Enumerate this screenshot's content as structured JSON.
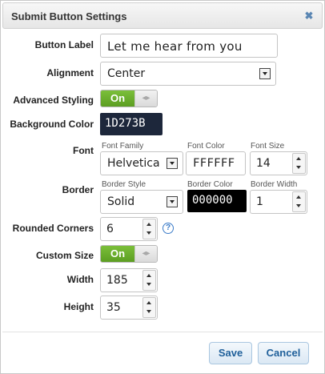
{
  "dialog": {
    "title": "Submit Button Settings",
    "close_glyph": "✖"
  },
  "fields": {
    "button_label": {
      "label": "Button Label",
      "value": "Let me hear from you"
    },
    "alignment": {
      "label": "Alignment",
      "value": "Center"
    },
    "advanced_styling": {
      "label": "Advanced Styling",
      "state": "On",
      "grip": "◂▸"
    },
    "background_color": {
      "label": "Background Color",
      "value": "1D273B",
      "color": "#1D273B"
    },
    "font": {
      "label": "Font",
      "family_label": "Font Family",
      "family_value": "Helvetica",
      "color_label": "Font Color",
      "color_value": "FFFFFF",
      "size_label": "Font Size",
      "size_value": "14"
    },
    "border": {
      "label": "Border",
      "style_label": "Border Style",
      "style_value": "Solid",
      "color_label": "Border Color",
      "color_value": "000000",
      "color": "#000000",
      "width_label": "Border Width",
      "width_value": "1"
    },
    "rounded_corners": {
      "label": "Rounded Corners",
      "value": "6",
      "help": "?"
    },
    "custom_size": {
      "label": "Custom Size",
      "state": "On",
      "grip": "◂▸"
    },
    "width": {
      "label": "Width",
      "value": "185"
    },
    "height": {
      "label": "Height",
      "value": "35"
    }
  },
  "footer": {
    "save_label": "Save",
    "cancel_label": "Cancel"
  },
  "colors": {
    "toggle_on": "#6aad2c",
    "link": "#1f5f9a",
    "accent_border": "#a9c6e0"
  }
}
